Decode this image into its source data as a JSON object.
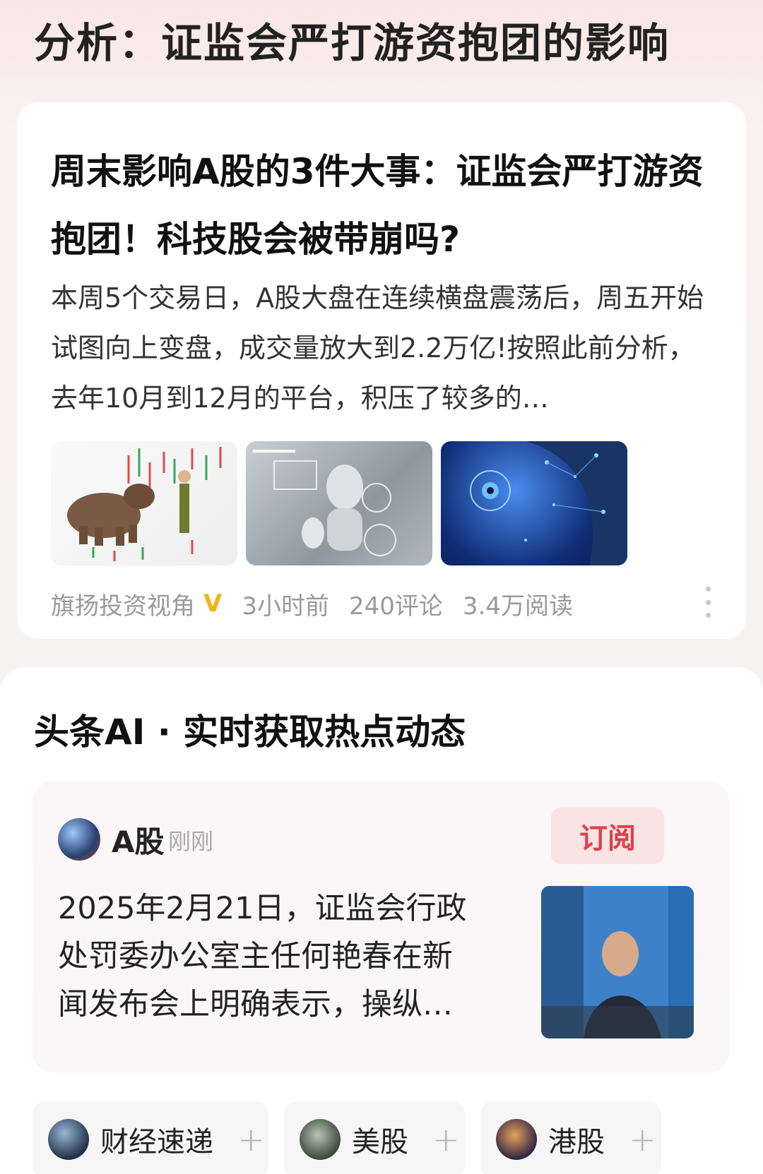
{
  "header": {
    "title": "分析：证监会严打游资抱团的影响"
  },
  "article": {
    "title": "周末影响A股的3件大事：证监会严打游资抱团！科技股会被带崩吗?",
    "summary": "本周5个交易日，A股大盘在连续横盘震荡后，周五开始试图向上变盘，成交量放大到2.2万亿!按照此前分析，去年10月到12月的平台，积压了较多的…",
    "author": "旗扬投资视角",
    "verified_badge": "V",
    "time": "3小时前",
    "comments": "240评论",
    "reads": "3.4万阅读"
  },
  "ai": {
    "title": "头条AI · 实时获取热点动态",
    "card": {
      "source": "A股",
      "time": "刚刚",
      "subscribe_label": "订阅",
      "text": "2025年2月21日，证监会行政处罚委办公室主任何艳春在新闻发布会上明确表示，操纵…"
    },
    "tags": [
      {
        "label": "财经速递",
        "plus": "+"
      },
      {
        "label": "美股",
        "plus": "+"
      },
      {
        "label": "港股",
        "plus": "+"
      }
    ]
  },
  "colors": {
    "accent_red": "#e0404a",
    "verified_gold": "#f2b518"
  }
}
